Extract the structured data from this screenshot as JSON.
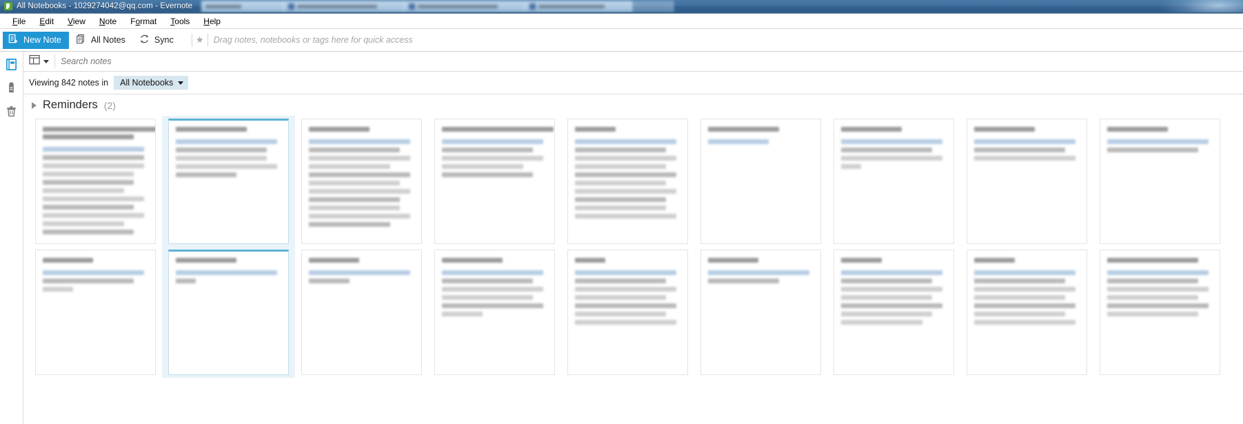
{
  "window": {
    "title": "All Notebooks - 1029274042@qq.com - Evernote",
    "logo_icon": "evernote-logo-icon"
  },
  "menubar": {
    "items": [
      {
        "label": "File",
        "accel": "F"
      },
      {
        "label": "Edit",
        "accel": "E"
      },
      {
        "label": "View",
        "accel": "V"
      },
      {
        "label": "Note",
        "accel": "N"
      },
      {
        "label": "Format",
        "accel": "o"
      },
      {
        "label": "Tools",
        "accel": "T"
      },
      {
        "label": "Help",
        "accel": "H"
      }
    ]
  },
  "toolbar": {
    "new_note_label": "New Note",
    "new_note_icon": "new-note-icon",
    "all_notes_label": "All Notes",
    "all_notes_icon": "all-notes-icon",
    "sync_label": "Sync",
    "sync_icon": "sync-icon",
    "star_icon": "star-icon",
    "quick_access_placeholder": "Drag notes, notebooks or tags here for quick access",
    "accent_color": "#2196d4"
  },
  "rail": {
    "items": [
      {
        "name": "notebooks-icon",
        "label": "Notebooks",
        "active": true
      },
      {
        "name": "tags-icon",
        "label": "Tags",
        "active": false
      },
      {
        "name": "trash-icon",
        "label": "Trash",
        "active": false
      }
    ]
  },
  "search": {
    "view_toggle_icon": "grid-view-icon",
    "caret_icon": "chevron-down-icon",
    "placeholder": "Search notes",
    "value": ""
  },
  "viewing": {
    "prefix": "Viewing 842 notes in",
    "count": 842,
    "notebook_selector_label": "All Notebooks",
    "notebook_caret_icon": "chevron-down-icon",
    "pill_color": "#d7e7ef"
  },
  "reminders": {
    "expander_icon": "triangle-right-icon",
    "title": "Reminders",
    "count": "(2)"
  },
  "notes_grid": {
    "selected_index": 1,
    "selection_color": "#5cb3d4",
    "selection_bg": "#e9f3f8",
    "columns": 9,
    "cards": [
      {
        "row": 1,
        "title_lines": [
          12,
          9
        ],
        "body_lines": [
          10,
          10,
          10,
          9,
          9,
          8,
          10,
          9,
          10,
          8,
          9
        ]
      },
      {
        "row": 1,
        "title_lines": [
          7
        ],
        "body_lines": [
          10,
          9,
          9,
          10,
          6
        ],
        "selected": true
      },
      {
        "row": 1,
        "title_lines": [
          6
        ],
        "body_lines": [
          10,
          9,
          10,
          8,
          10,
          9,
          10,
          9,
          9,
          10,
          8
        ]
      },
      {
        "row": 1,
        "title_lines": [
          11
        ],
        "body_lines": [
          10,
          9,
          10,
          8,
          9
        ]
      },
      {
        "row": 1,
        "title_lines": [
          4
        ],
        "body_lines": [
          10,
          9,
          10,
          9,
          10,
          9,
          10,
          9,
          9,
          10
        ]
      },
      {
        "row": 1,
        "title_lines": [
          7
        ],
        "body_lines": [
          6
        ]
      },
      {
        "row": 1,
        "title_lines": [
          6
        ],
        "body_lines": [
          10,
          9,
          10,
          2
        ]
      },
      {
        "row": 1,
        "title_lines": [
          6
        ],
        "body_lines": [
          10,
          9,
          10
        ]
      },
      {
        "row": 1,
        "title_lines": [
          6
        ],
        "body_lines": [
          10,
          9
        ]
      },
      {
        "row": 2,
        "title_lines": [
          5
        ],
        "body_lines": [
          10,
          9,
          3
        ]
      },
      {
        "row": 2,
        "title_lines": [
          6
        ],
        "body_lines": [
          10,
          2
        ],
        "selected": true
      },
      {
        "row": 2,
        "title_lines": [
          5
        ],
        "body_lines": [
          10,
          4
        ]
      },
      {
        "row": 2,
        "title_lines": [
          6
        ],
        "body_lines": [
          10,
          9,
          10,
          9,
          10,
          4
        ]
      },
      {
        "row": 2,
        "title_lines": [
          3
        ],
        "body_lines": [
          10,
          9,
          10,
          9,
          10,
          9,
          10
        ]
      },
      {
        "row": 2,
        "title_lines": [
          5
        ],
        "body_lines": [
          10,
          7
        ]
      },
      {
        "row": 2,
        "title_lines": [
          4
        ],
        "body_lines": [
          10,
          9,
          10,
          9,
          10,
          9,
          8
        ]
      },
      {
        "row": 2,
        "title_lines": [
          4
        ],
        "body_lines": [
          10,
          9,
          10,
          9,
          10,
          9,
          10
        ]
      },
      {
        "row": 2,
        "title_lines": [
          9
        ],
        "body_lines": [
          10,
          9,
          10,
          9,
          10,
          9
        ]
      }
    ]
  }
}
